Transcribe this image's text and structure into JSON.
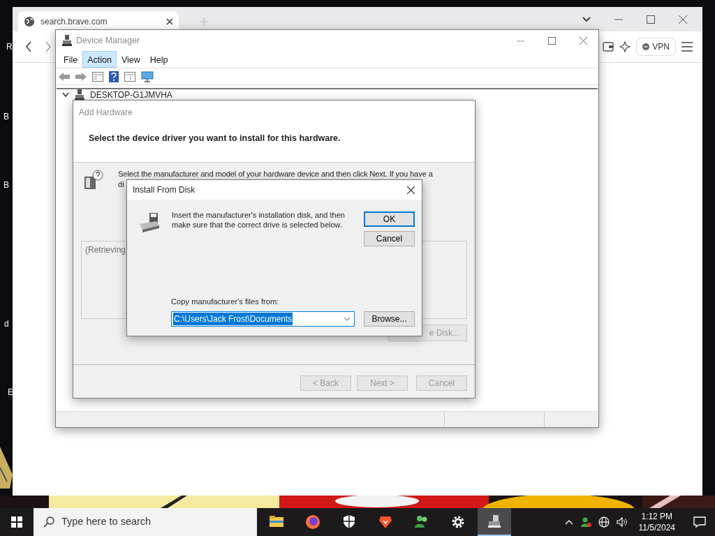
{
  "desktop_labels": [
    {
      "label": "R"
    },
    {
      "label": "B"
    },
    {
      "label": "B"
    },
    {
      "label": "d"
    },
    {
      "label": "E"
    }
  ],
  "browser": {
    "tab_title": "search.brave.com",
    "vpn_label": "VPN"
  },
  "device_manager": {
    "title": "Device Manager",
    "menu": [
      {
        "label": "File",
        "selected": false
      },
      {
        "label": "Action",
        "selected": true
      },
      {
        "label": "View",
        "selected": false
      },
      {
        "label": "Help",
        "selected": false
      }
    ],
    "tree_root": {
      "label": "DESKTOP-G1JMVHA",
      "expanded": true
    }
  },
  "add_hardware": {
    "title": "Add Hardware",
    "heading": "Select the device driver you want to install for this hardware.",
    "instruction": "Select the manufacturer and model of your hardware device and then click Next. If you have a",
    "instruction_cut": "di",
    "list_text": "(Retrieving",
    "have_disk": {
      "label": "e Disk...",
      "disabled": true
    },
    "buttons": [
      {
        "label": "< Back",
        "disabled": true
      },
      {
        "label": "Next >",
        "disabled": true
      },
      {
        "label": "Cancel",
        "disabled": true
      }
    ]
  },
  "install_dialog": {
    "title": "Install From Disk",
    "message": "Insert the manufacturer's installation disk, and then make sure that the correct drive is selected below.",
    "ok": "OK",
    "cancel": "Cancel",
    "copy_label": "Copy manufacturer's files from:",
    "path": "C:\\Users\\Jack Frost\\Documents",
    "browse": "Browse..."
  },
  "taskbar": {
    "search_placeholder": "Type here to search",
    "apps": [
      {
        "kind": "folder",
        "selected": false
      },
      {
        "kind": "firefox",
        "selected": false
      },
      {
        "kind": "shield",
        "selected": false
      },
      {
        "kind": "lion",
        "selected": false
      },
      {
        "kind": "people",
        "selected": false
      },
      {
        "kind": "gear",
        "selected": false
      },
      {
        "kind": "devmgr",
        "selected": true
      }
    ],
    "time": "1:12 PM",
    "date": "11/5/2024"
  }
}
